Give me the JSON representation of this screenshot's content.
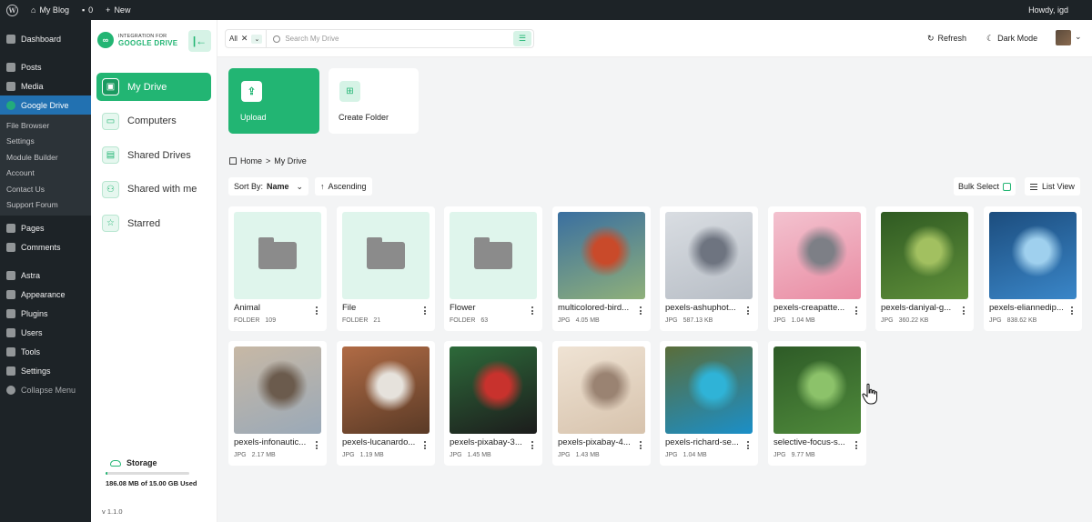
{
  "adminbar": {
    "site_name": "My Blog",
    "comments_count": "0",
    "new_label": "New",
    "howdy": "Howdy, igd"
  },
  "wp_menu": {
    "items": [
      "Dashboard",
      "Posts",
      "Media",
      "Google Drive"
    ],
    "active": "Google Drive",
    "submenu": [
      "File Browser",
      "Settings",
      "Module Builder",
      "Account",
      "Contact Us",
      "Support Forum"
    ],
    "items_after": [
      "Pages",
      "Comments",
      "Astra",
      "Appearance",
      "Plugins",
      "Users",
      "Tools",
      "Settings",
      "Collapse Menu"
    ]
  },
  "brand": {
    "line1": "INTEGRATION FOR",
    "line2": "GOOGLE DRIVE"
  },
  "nav": [
    {
      "label": "My Drive",
      "icon": "drive-icon",
      "active": true
    },
    {
      "label": "Computers",
      "icon": "computer-icon",
      "active": false
    },
    {
      "label": "Shared Drives",
      "icon": "shared-drive-icon",
      "active": false
    },
    {
      "label": "Shared with me",
      "icon": "users-icon",
      "active": false
    },
    {
      "label": "Starred",
      "icon": "star-icon",
      "active": false
    }
  ],
  "storage": {
    "title": "Storage",
    "used_text": "186.08 MB of 15.00 GB Used",
    "used_fraction": 0.012
  },
  "version": "v 1.1.0",
  "header": {
    "filter_value": "All",
    "search_placeholder": "Search My Drive",
    "refresh_label": "Refresh",
    "dark_mode_label": "Dark Mode"
  },
  "actions": {
    "upload_label": "Upload",
    "create_folder_label": "Create Folder"
  },
  "breadcrumb": {
    "home": "Home",
    "separator": ">",
    "current": "My Drive"
  },
  "toolbar": {
    "sort_by_label": "Sort By:",
    "sort_by_value": "Name",
    "sort_direction": "Ascending",
    "bulk_select_label": "Bulk Select",
    "view_label": "List View"
  },
  "files": [
    {
      "name": "Animal",
      "type": "FOLDER",
      "meta": "109",
      "kind": "folder"
    },
    {
      "name": "File",
      "type": "FOLDER",
      "meta": "21",
      "kind": "folder"
    },
    {
      "name": "Flower",
      "type": "FOLDER",
      "meta": "63",
      "kind": "folder"
    },
    {
      "name": "multicolored-bird...",
      "type": "JPG",
      "meta": "4.05 MB",
      "kind": "image",
      "colors": [
        "#8fb07a",
        "#c94a2a",
        "#3a6fa0"
      ]
    },
    {
      "name": "pexels-ashuphot...",
      "type": "JPG",
      "meta": "587.13 KB",
      "kind": "image",
      "colors": [
        "#b8bec6",
        "#6e7480",
        "#d9dde2"
      ]
    },
    {
      "name": "pexels-creapatte...",
      "type": "JPG",
      "meta": "1.04 MB",
      "kind": "image",
      "colors": [
        "#e98ca3",
        "#7d7f86",
        "#f3c2cf"
      ]
    },
    {
      "name": "pexels-daniyal-g...",
      "type": "JPG",
      "meta": "360.22 KB",
      "kind": "image",
      "colors": [
        "#5f8f3a",
        "#a2c060",
        "#2f5a22"
      ]
    },
    {
      "name": "pexels-eliannedip...",
      "type": "JPG",
      "meta": "838.62 KB",
      "kind": "image",
      "colors": [
        "#3a86c8",
        "#9fd0ee",
        "#1c4d7e"
      ]
    },
    {
      "name": "pexels-infonautic...",
      "type": "JPG",
      "meta": "2.17 MB",
      "kind": "image",
      "colors": [
        "#9aa9b8",
        "#6b5b4d",
        "#c7b8a5"
      ]
    },
    {
      "name": "pexels-lucanardo...",
      "type": "JPG",
      "meta": "1.19 MB",
      "kind": "image",
      "colors": [
        "#5a3a26",
        "#e6e2dc",
        "#b06b45"
      ]
    },
    {
      "name": "pexels-pixabay-3...",
      "type": "JPG",
      "meta": "1.45 MB",
      "kind": "image",
      "colors": [
        "#1c1c1c",
        "#c8322d",
        "#2d6a3a"
      ]
    },
    {
      "name": "pexels-pixabay-4...",
      "type": "JPG",
      "meta": "1.43 MB",
      "kind": "image",
      "colors": [
        "#d7c3ad",
        "#9a8372",
        "#efe3d4"
      ]
    },
    {
      "name": "pexels-richard-se...",
      "type": "JPG",
      "meta": "1.04 MB",
      "kind": "image",
      "colors": [
        "#1b8fc8",
        "#2fb3d7",
        "#5a6d3a"
      ]
    },
    {
      "name": "selective-focus-s...",
      "type": "JPG",
      "meta": "9.77 MB",
      "kind": "image",
      "colors": [
        "#4f8a3b",
        "#8cc26a",
        "#2e5b27"
      ]
    }
  ],
  "colors": {
    "accent": "#22b573",
    "accent_light": "#d6f3e6",
    "wp_dark": "#1d2327",
    "wp_active": "#2271b1"
  }
}
